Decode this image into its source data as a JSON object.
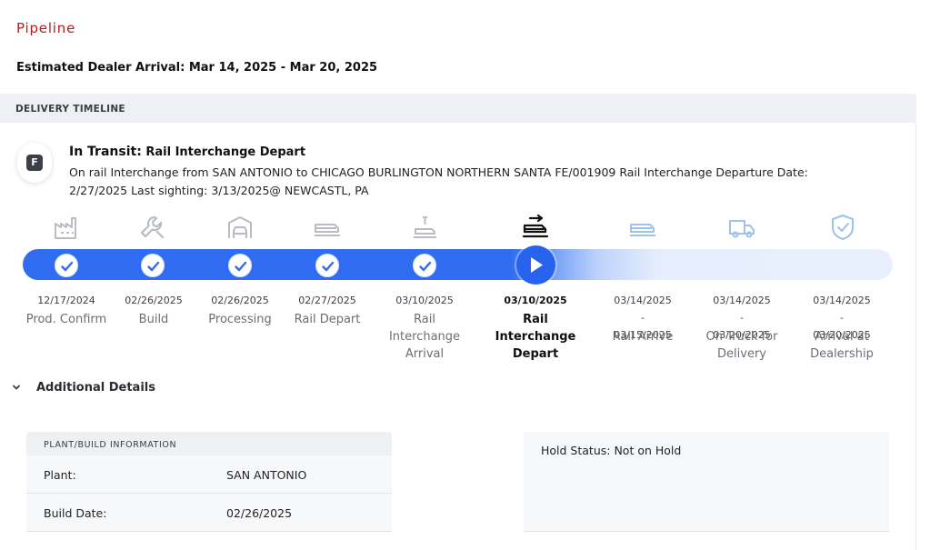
{
  "page": {
    "title": "Pipeline",
    "eta": "Estimated Dealer Arrival: Mar 14, 2025 - Mar 20, 2025"
  },
  "timeline": {
    "header": "DELIVERY TIMELINE",
    "badge": "F",
    "status_label": "In Transit:",
    "status_value": "Rail Interchange Depart",
    "description": "On rail Interchange from SAN ANTONIO to CHICAGO BURLINGTON NORTHERN SANTA FE/001909 Rail Interchange Departure Date: 2/27/2025 Last sighting: 3/13/2025@ NEWCASTL, PA",
    "progress_percent": 58,
    "steps": [
      {
        "date": "12/17/2024",
        "label": "Prod. Confirm",
        "state": "done",
        "icon": "factory-icon"
      },
      {
        "date": "02/26/2025",
        "label": "Build",
        "state": "done",
        "icon": "wrench-icon"
      },
      {
        "date": "02/26/2025",
        "label": "Processing",
        "state": "done",
        "icon": "car-garage-icon"
      },
      {
        "date": "02/27/2025",
        "label": "Rail Depart",
        "state": "done",
        "icon": "train-icon"
      },
      {
        "date": "03/10/2025",
        "label": "Rail Interchange Arrival",
        "state": "done",
        "icon": "rail-arrival-icon"
      },
      {
        "date": "03/10/2025",
        "label": "Rail Interchange Depart",
        "state": "current",
        "icon": "rail-depart-icon"
      },
      {
        "date": "03/14/2025 - 03/15/2025",
        "label": "Rail Arrive",
        "state": "pending",
        "icon": "train-icon"
      },
      {
        "date": "03/14/2025 - 03/20/2025",
        "label": "On Truck for Delivery",
        "state": "pending",
        "icon": "truck-icon"
      },
      {
        "date": "03/14/2025 - 03/20/2025",
        "label": "Arrival at Dealership",
        "state": "pending",
        "icon": "shield-check-icon"
      }
    ]
  },
  "additional": {
    "toggle_label": "Additional Details",
    "plant_card": {
      "header": "PLANT/BUILD INFORMATION",
      "plant_label": "Plant:",
      "plant_value": "SAN ANTONIO",
      "build_date_label": "Build Date:",
      "build_date_value": "02/26/2025"
    },
    "hold_status": "Hold Status: Not on Hold"
  },
  "colors": {
    "brand_red": "#b51c1c",
    "progress_blue": "#2f6cf2",
    "pending_track": "#e9f0fd",
    "done_icon": "#b9bcc2",
    "pending_icon": "#9fc1ec"
  }
}
